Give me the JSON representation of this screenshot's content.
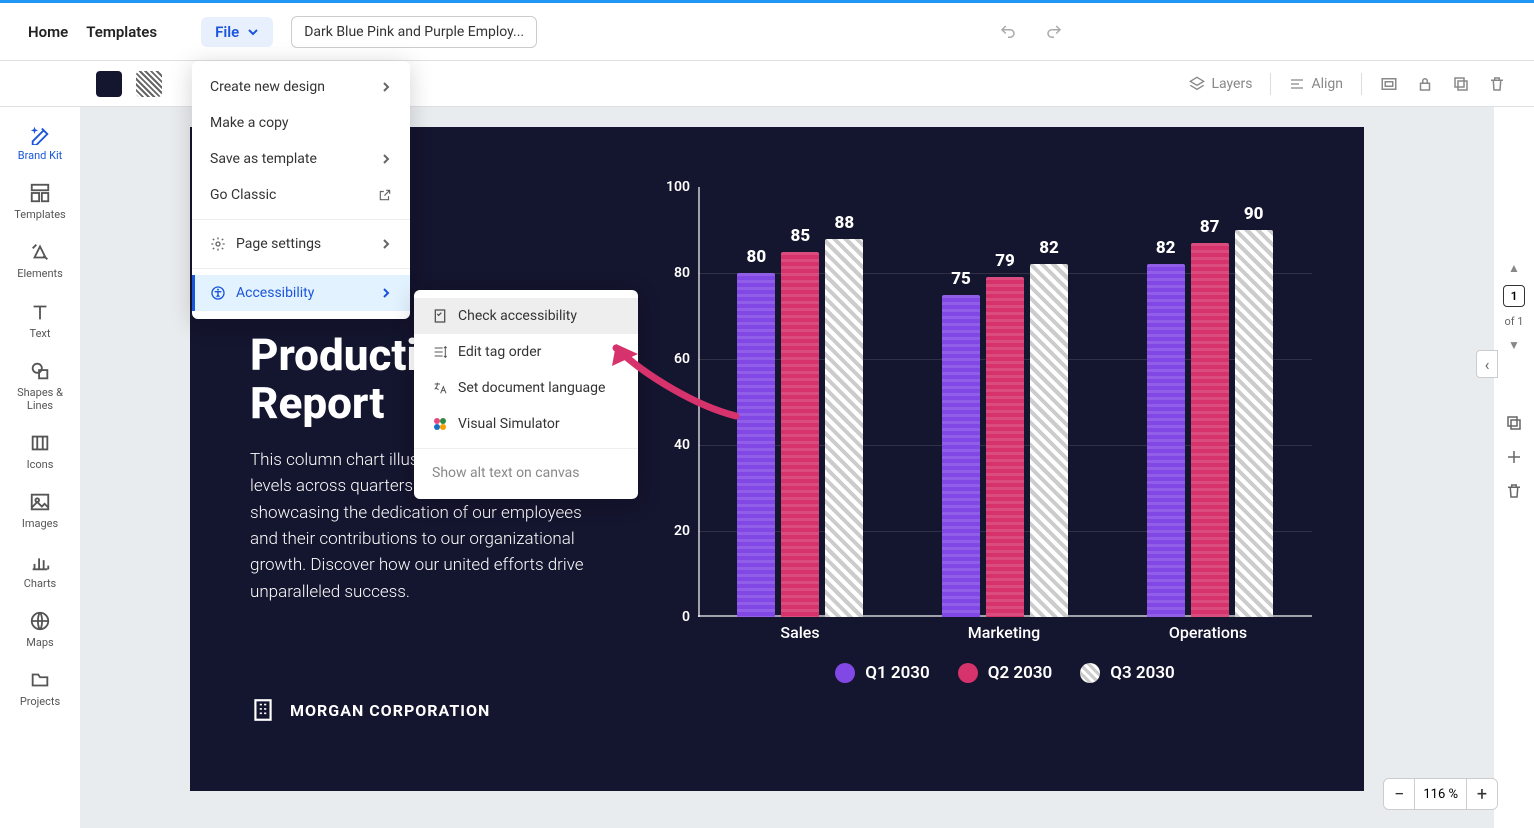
{
  "toolbar": {
    "home": "Home",
    "templates": "Templates",
    "file": "File",
    "doc_title": "Dark Blue Pink and Purple Employ..."
  },
  "second_bar": {
    "layers": "Layers",
    "align": "Align"
  },
  "left_rail": [
    {
      "label": "Brand Kit"
    },
    {
      "label": "Templates"
    },
    {
      "label": "Elements"
    },
    {
      "label": "Text"
    },
    {
      "label": "Shapes & Lines"
    },
    {
      "label": "Icons"
    },
    {
      "label": "Images"
    },
    {
      "label": "Charts"
    },
    {
      "label": "Maps"
    },
    {
      "label": "Projects"
    }
  ],
  "file_menu": {
    "create": "Create new design",
    "copy": "Make a copy",
    "save_tpl": "Save as template",
    "classic": "Go Classic",
    "page_settings": "Page settings",
    "accessibility": "Accessibility"
  },
  "accessibility_menu": {
    "check": "Check accessibility",
    "tag_order": "Edit tag order",
    "lang": "Set document language",
    "visual": "Visual Simulator",
    "alt": "Show alt text on canvas"
  },
  "slide": {
    "title_l1": "Productivity",
    "title_l2": "Report",
    "body": "This column chart illustrates the productivity levels across quarters and departments, showcasing the dedication of our employees and their contributions to our organizational growth. Discover how our united efforts drive unparalleled success.",
    "corp": "MORGAN CORPORATION"
  },
  "chart_data": {
    "type": "bar",
    "categories": [
      "Sales",
      "Marketing",
      "Operations"
    ],
    "series": [
      {
        "name": "Q1 2030",
        "values": [
          80,
          75,
          82
        ],
        "color": "#8248e5"
      },
      {
        "name": "Q2 2030",
        "values": [
          85,
          79,
          87
        ],
        "color": "#d6336c"
      },
      {
        "name": "Q3 2030",
        "values": [
          88,
          82,
          90
        ],
        "color": "hatch-white"
      }
    ],
    "ylim": [
      0,
      100
    ],
    "yticks": [
      0,
      20,
      40,
      60,
      80,
      100
    ]
  },
  "right_rail": {
    "page": "1",
    "of": "of 1"
  },
  "zoom": "116 %"
}
